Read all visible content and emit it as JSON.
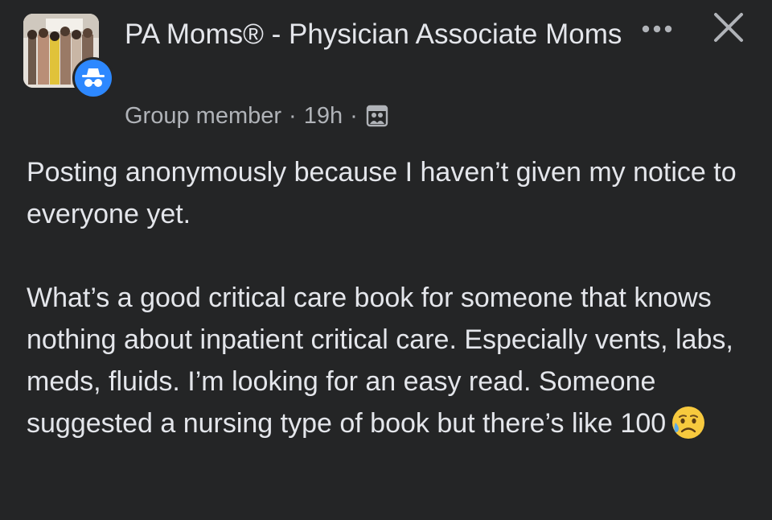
{
  "post": {
    "group_name": "PA Moms® - Physician Associate Moms",
    "author_role": "Group member",
    "separator": "·",
    "time_ago": "19h",
    "audience_icon": "group-audience-icon",
    "paragraphs": [
      "Posting anonymously because I haven’t given my notice to everyone yet.",
      "What’s a good critical care book for someone that knows nothing about inpatient critical care. Especially vents, labs, meds, fluids. I’m looking for an easy read. Someone suggested a nursing type of book but there’s like 100"
    ],
    "trailing_emoji": "sad-but-relieved-face"
  },
  "actions": {
    "more_icon": "more-options-icon",
    "close_icon": "close-icon"
  },
  "colors": {
    "background": "#242526",
    "primary_text": "#e4e6eb",
    "secondary_text": "#b0b3b8",
    "anonymous_badge": "#2d88ff"
  }
}
